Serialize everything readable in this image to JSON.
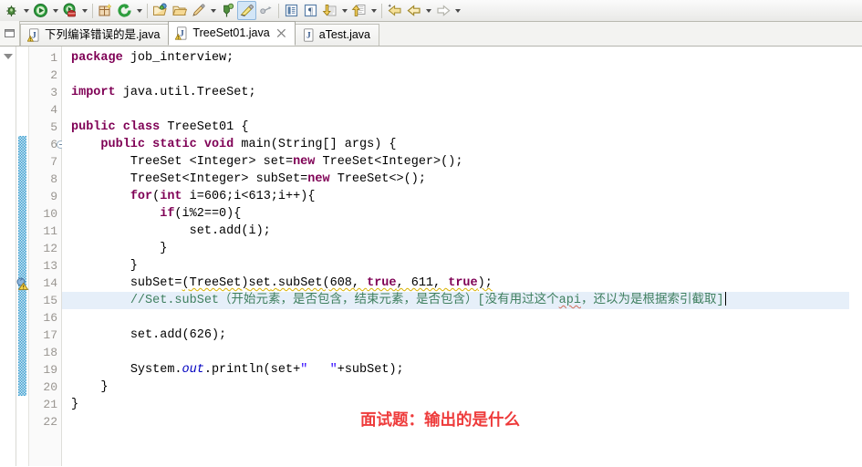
{
  "toolbar": {
    "items": [
      {
        "name": "debug-icon",
        "type": "button",
        "glyph": "bug"
      },
      {
        "name": "debug-dropdown-arrow",
        "type": "arrow"
      },
      {
        "name": "run-icon",
        "type": "button",
        "glyph": "run"
      },
      {
        "name": "run-dropdown-arrow",
        "type": "arrow"
      },
      {
        "name": "run-external-tools-icon",
        "type": "button",
        "glyph": "toolbox"
      },
      {
        "name": "external-tools-dropdown-arrow",
        "type": "arrow"
      },
      {
        "name": "new-package-icon",
        "type": "button",
        "glyph": "package"
      },
      {
        "name": "refresh-icon",
        "type": "button",
        "glyph": "refresh"
      },
      {
        "name": "refresh-dropdown-arrow",
        "type": "arrow"
      },
      {
        "name": "open-type-icon",
        "type": "button",
        "glyph": "open-folder-blue"
      },
      {
        "name": "open-resource-icon",
        "type": "button",
        "glyph": "open-folder"
      },
      {
        "name": "pencil-icon",
        "type": "button",
        "glyph": "pencil"
      },
      {
        "name": "pencil-dropdown-arrow",
        "type": "arrow"
      },
      {
        "name": "search-pin-icon",
        "type": "button",
        "glyph": "pin"
      },
      {
        "name": "highlight-marker-icon",
        "type": "button",
        "glyph": "marker",
        "active": true
      },
      {
        "name": "link-icon",
        "type": "button",
        "glyph": "link"
      },
      {
        "name": "toggle-block-selection-icon",
        "type": "button",
        "glyph": "block-sel"
      },
      {
        "name": "show-whitespace-icon",
        "type": "button",
        "glyph": "pilcrow"
      },
      {
        "name": "next-annotation-icon",
        "type": "button",
        "glyph": "down-arrow-doc"
      },
      {
        "name": "next-annotation-dropdown-arrow",
        "type": "arrow"
      },
      {
        "name": "previous-annotation-icon",
        "type": "button",
        "glyph": "up-arrow-doc"
      },
      {
        "name": "previous-annotation-dropdown-arrow",
        "type": "arrow"
      },
      {
        "name": "last-edit-location-icon",
        "type": "button",
        "glyph": "back-star"
      },
      {
        "name": "back-icon",
        "type": "button",
        "glyph": "back"
      },
      {
        "name": "back-dropdown-arrow",
        "type": "arrow"
      },
      {
        "name": "forward-icon",
        "type": "button",
        "glyph": "forward"
      },
      {
        "name": "forward-dropdown-arrow",
        "type": "arrow"
      }
    ]
  },
  "tabs": [
    {
      "label": "下列编译错误的是.java",
      "active": false,
      "warning": true,
      "closable": false
    },
    {
      "label": "TreeSet01.java",
      "active": true,
      "warning": true,
      "closable": true
    },
    {
      "label": "aTest.java",
      "active": false,
      "warning": false,
      "closable": false
    }
  ],
  "editor": {
    "current_line": 15,
    "change_bar_from_line": 6,
    "change_bar_to_line": 20,
    "warning_marker_line": 14,
    "fold_marker_line": 6,
    "line_numbers": [
      1,
      2,
      3,
      4,
      5,
      6,
      7,
      8,
      9,
      10,
      11,
      12,
      13,
      14,
      15,
      16,
      17,
      18,
      19,
      20,
      21,
      22
    ],
    "lines": [
      {
        "n": 1,
        "text": "package job_interview;"
      },
      {
        "n": 2,
        "text": ""
      },
      {
        "n": 3,
        "text": "import java.util.TreeSet;"
      },
      {
        "n": 4,
        "text": ""
      },
      {
        "n": 5,
        "text": "public class TreeSet01 {"
      },
      {
        "n": 6,
        "text": "    public static void main(String[] args) {"
      },
      {
        "n": 7,
        "text": "        TreeSet <Integer> set=new TreeSet<Integer>();"
      },
      {
        "n": 8,
        "text": "        TreeSet<Integer> subSet=new TreeSet<>();"
      },
      {
        "n": 9,
        "text": "        for(int i=606;i<613;i++){"
      },
      {
        "n": 10,
        "text": "            if(i%2==0){"
      },
      {
        "n": 11,
        "text": "                set.add(i);"
      },
      {
        "n": 12,
        "text": "            }"
      },
      {
        "n": 13,
        "text": "        }"
      },
      {
        "n": 14,
        "text": "        subSet=(TreeSet)set.subSet(608, true, 611, true);"
      },
      {
        "n": 15,
        "text": "        //Set.subSet（开始元素，是否包含，结束元素，是否包含）[没有用过这个api，还以为是根据索引截取]"
      },
      {
        "n": 16,
        "text": ""
      },
      {
        "n": 17,
        "text": "        set.add(626);"
      },
      {
        "n": 18,
        "text": ""
      },
      {
        "n": 19,
        "text": "        System.out.println(set+\"   \"+subSet);"
      },
      {
        "n": 20,
        "text": "    }"
      },
      {
        "n": 21,
        "text": "}"
      },
      {
        "n": 22,
        "text": ""
      }
    ],
    "annotation": {
      "text": "面试题：输出的是什么",
      "color": "#ee3b3b"
    }
  },
  "colors": {
    "keyword": "#7f0055",
    "comment": "#3f7f5f",
    "string": "#2a00ff",
    "field": "#0000c0",
    "current_line_highlight": "#e6eff9",
    "change_bar": "#3f9fd0",
    "annotation_red": "#ee3b3b",
    "warning_squiggle": "#d8b100"
  }
}
